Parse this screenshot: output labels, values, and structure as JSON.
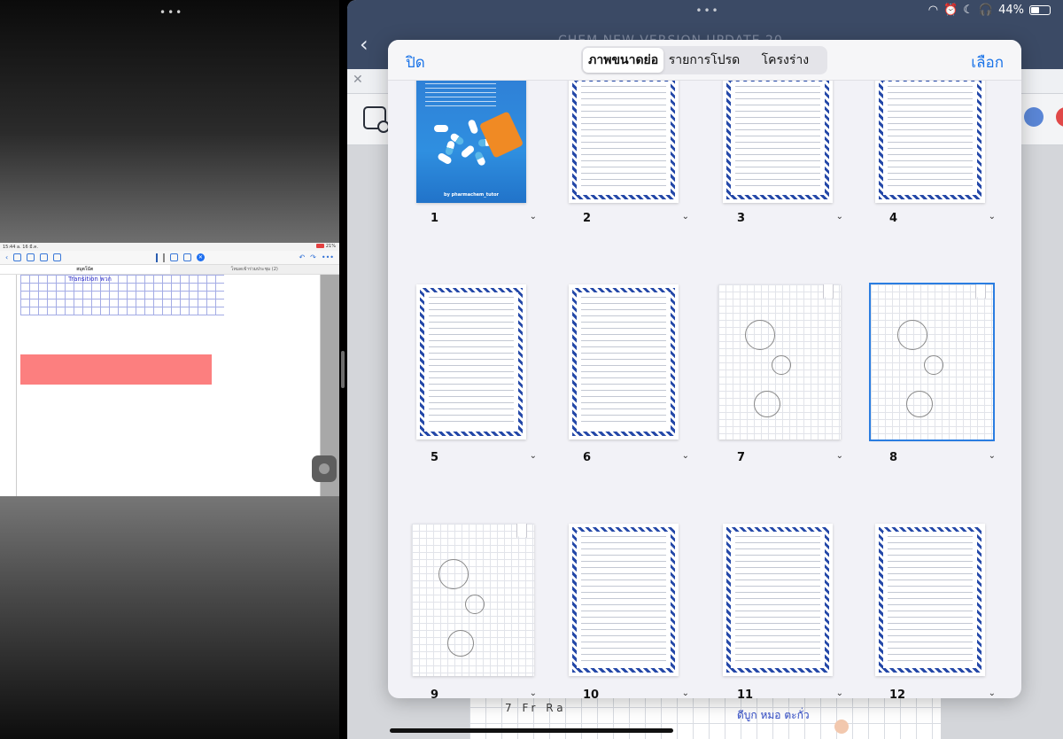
{
  "status_bar": {
    "battery": "44%"
  },
  "split_handles": {
    "left_dots": "•••",
    "right_dots": "•••"
  },
  "background_doc": {
    "title": "CHEM NEW VERSION UPDATE 20",
    "canvas_notes_left": "7 Fr Ra",
    "canvas_notes_blue": "ดีบูก  หมอ  ตะกั่ว"
  },
  "mini_app": {
    "time": "15:44",
    "date": "a. 16 มี.ค.",
    "battery": "21%",
    "tabs": [
      "สมุดโน้ต",
      "โหมดเข้าร่วมประชุม (2)"
    ],
    "scribble": "Transition พวก"
  },
  "page_overview": {
    "close_label": "ปิด",
    "select_label": "เลือก",
    "segments": [
      "ภาพขนาดย่อ",
      "รายการโปรด",
      "โครงร่าง"
    ],
    "active_segment": 0,
    "cover_credit": "by pharmachem_tutor",
    "pages": [
      {
        "num": "1",
        "style": "cover"
      },
      {
        "num": "2",
        "style": "checker"
      },
      {
        "num": "3",
        "style": "checker"
      },
      {
        "num": "4",
        "style": "checker"
      },
      {
        "num": "5",
        "style": "checker"
      },
      {
        "num": "6",
        "style": "checker"
      },
      {
        "num": "7",
        "style": "grid"
      },
      {
        "num": "8",
        "style": "grid",
        "selected": true
      },
      {
        "num": "9",
        "style": "grid"
      },
      {
        "num": "10",
        "style": "checker"
      },
      {
        "num": "11",
        "style": "checker"
      },
      {
        "num": "12",
        "style": "checker"
      }
    ]
  },
  "colors": {
    "accent": "#1a73e8",
    "app_bar": "#3b4a65",
    "checker_border": "#2448a8",
    "selection": "#2a7de1",
    "mini_red_block": "#fc7f7f"
  }
}
